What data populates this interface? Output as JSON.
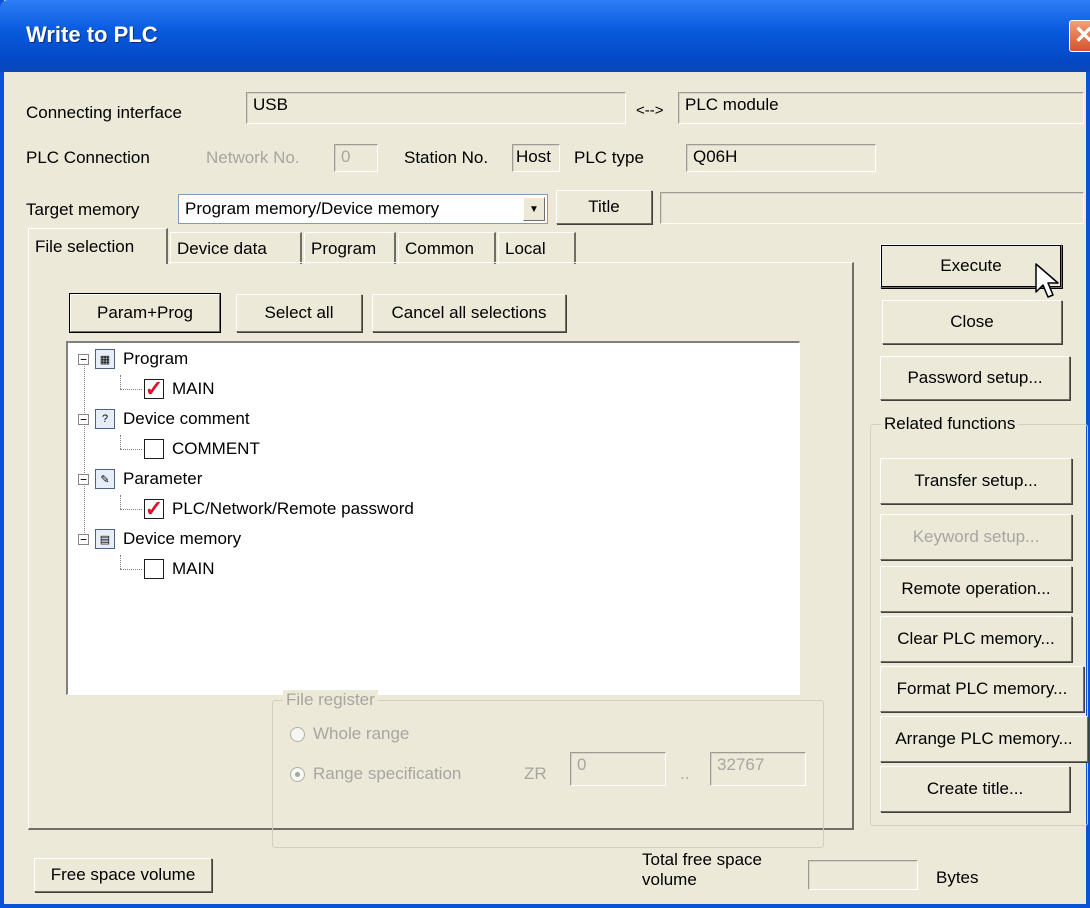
{
  "window": {
    "title": "Write to PLC",
    "close_glyph": "✕"
  },
  "connection": {
    "interface_label": "Connecting interface",
    "interface_value": "USB",
    "arrow": "<-->",
    "target_value": "PLC module",
    "plc_connection_label": "PLC Connection",
    "network_label": "Network No.",
    "network_value": "0",
    "station_label": "Station No.",
    "station_value": "Host",
    "plc_type_label": "PLC type",
    "plc_type_value": "Q06H"
  },
  "target_memory": {
    "label": "Target memory",
    "selected": "Program memory/Device memory",
    "title_button": "Title",
    "title_value": ""
  },
  "tabs": [
    {
      "label": "File selection",
      "active": true
    },
    {
      "label": "Device data",
      "active": false
    },
    {
      "label": "Program",
      "active": false
    },
    {
      "label": "Common",
      "active": false
    },
    {
      "label": "Local",
      "active": false
    }
  ],
  "selection_buttons": {
    "param_prog": "Param+Prog",
    "select_all": "Select all",
    "cancel_all": "Cancel all selections"
  },
  "tree": [
    {
      "label": "Program",
      "icon": "program-icon",
      "children": [
        {
          "label": "MAIN",
          "checked": true
        }
      ]
    },
    {
      "label": "Device comment",
      "icon": "device-comment-icon",
      "children": [
        {
          "label": "COMMENT",
          "checked": false
        }
      ]
    },
    {
      "label": "Parameter",
      "icon": "parameter-icon",
      "children": [
        {
          "label": "PLC/Network/Remote password",
          "checked": true
        }
      ]
    },
    {
      "label": "Device memory",
      "icon": "device-memory-icon",
      "children": [
        {
          "label": "MAIN",
          "checked": false
        }
      ]
    }
  ],
  "file_register": {
    "legend": "File register",
    "whole_range": "Whole range",
    "range_spec": "Range specification",
    "zr_label": "ZR",
    "from": "0",
    "sep": "..",
    "to": "32767",
    "selected": "range_spec"
  },
  "side_buttons": {
    "execute": "Execute",
    "close": "Close",
    "password": "Password setup...",
    "related_legend": "Related functions",
    "transfer": "Transfer setup...",
    "keyword": "Keyword setup...",
    "remote": "Remote operation...",
    "clear": "Clear PLC memory...",
    "format": "Format PLC memory...",
    "arrange": "Arrange PLC memory...",
    "create_title": "Create title..."
  },
  "footer": {
    "free_space_button": "Free space volume",
    "total_label_line1": "Total free space",
    "total_label_line2": "volume",
    "total_value": "",
    "unit": "Bytes"
  },
  "colors": {
    "titlebar": "#0a5ce0",
    "dialog_bg": "#ece9d8",
    "check_mark": "#e0102a"
  }
}
